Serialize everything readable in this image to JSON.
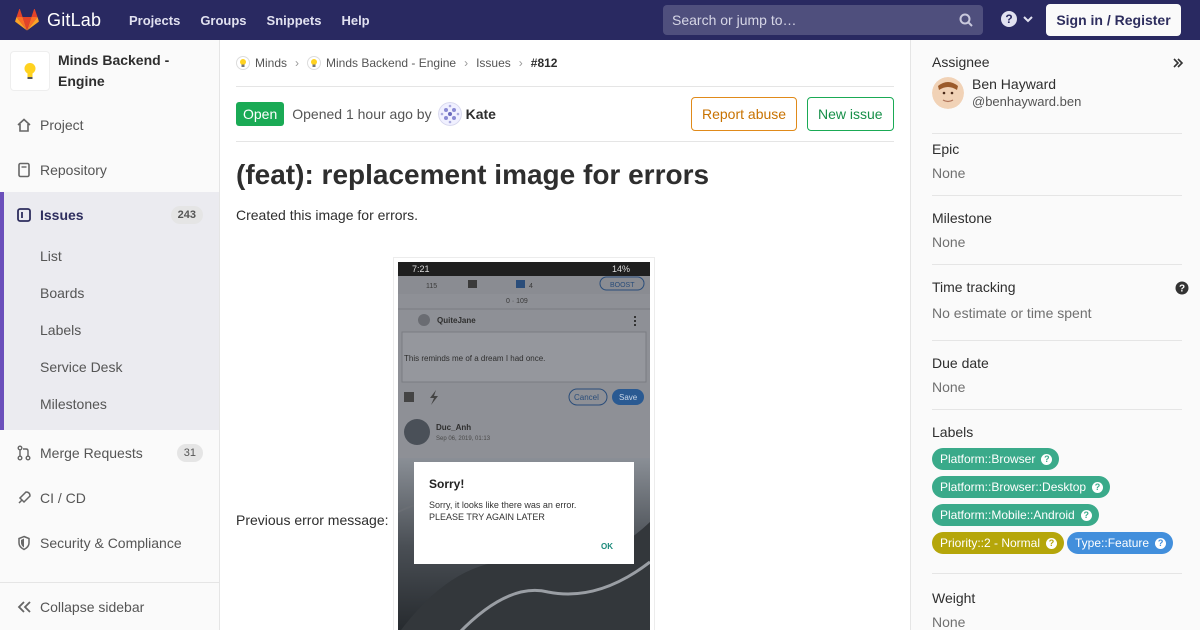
{
  "navbar": {
    "brand": "GitLab",
    "links": [
      "Projects",
      "Groups",
      "Snippets",
      "Help"
    ],
    "search_placeholder": "Search or jump to…",
    "signin_label": "Sign in / Register"
  },
  "sidebar": {
    "project_name": "Minds Backend - Engine",
    "items": [
      {
        "label": "Project",
        "icon": "home-icon"
      },
      {
        "label": "Repository",
        "icon": "doc-icon"
      },
      {
        "label": "Issues",
        "icon": "issues-icon",
        "count": "243"
      },
      {
        "label": "Merge Requests",
        "icon": "merge-request-icon",
        "count": "31"
      },
      {
        "label": "CI / CD",
        "icon": "rocket-icon"
      },
      {
        "label": "Security & Compliance",
        "icon": "shield-icon"
      }
    ],
    "sub_items": [
      "List",
      "Boards",
      "Labels",
      "Service Desk",
      "Milestones"
    ],
    "collapse_label": "Collapse sidebar"
  },
  "breadcrumb": [
    "Minds",
    "Minds Backend - Engine",
    "Issues",
    "#812"
  ],
  "issue": {
    "status": "Open",
    "opened_text": "Opened 1 hour ago by",
    "author": "Kate",
    "report_label": "Report abuse",
    "new_issue_label": "New issue",
    "title": "(feat): replacement image for errors",
    "description": "Created this image for errors.",
    "prev_label": "Previous error message:"
  },
  "screenshot": {
    "time": "7:21",
    "battery": "14%",
    "likes": "115",
    "comments": "4",
    "boost": "BOOST",
    "views": "0 · 109",
    "user1": "QuiteJane",
    "comment": "This reminds me of a dream I had once.",
    "cancel": "Cancel",
    "save": "Save",
    "user2": "Duc_Anh",
    "date": "Sep 06, 2019, 01:13",
    "dialog_title": "Sorry!",
    "dialog_text1": "Sorry, it looks like there was an error.",
    "dialog_text2": "PLEASE TRY AGAIN LATER",
    "dialog_ok": "OK"
  },
  "rightbar": {
    "assignee_title": "Assignee",
    "assignee_name": "Ben Hayward",
    "assignee_handle": "@benhayward.ben",
    "epic_title": "Epic",
    "epic_value": "None",
    "milestone_title": "Milestone",
    "milestone_value": "None",
    "time_title": "Time tracking",
    "time_value": "No estimate or time spent",
    "due_title": "Due date",
    "due_value": "None",
    "labels_title": "Labels",
    "labels": [
      {
        "text": "Platform::Browser",
        "color": "#3aaa8a"
      },
      {
        "text": "Platform::Browser::Desktop",
        "color": "#3aaa8a"
      },
      {
        "text": "Platform::Mobile::Android",
        "color": "#3aaa8a"
      },
      {
        "text": "Priority::2 - Normal",
        "color": "#b5a60a"
      },
      {
        "text": "Type::Feature",
        "color": "#428fdc"
      }
    ],
    "weight_title": "Weight",
    "weight_value": "None"
  }
}
